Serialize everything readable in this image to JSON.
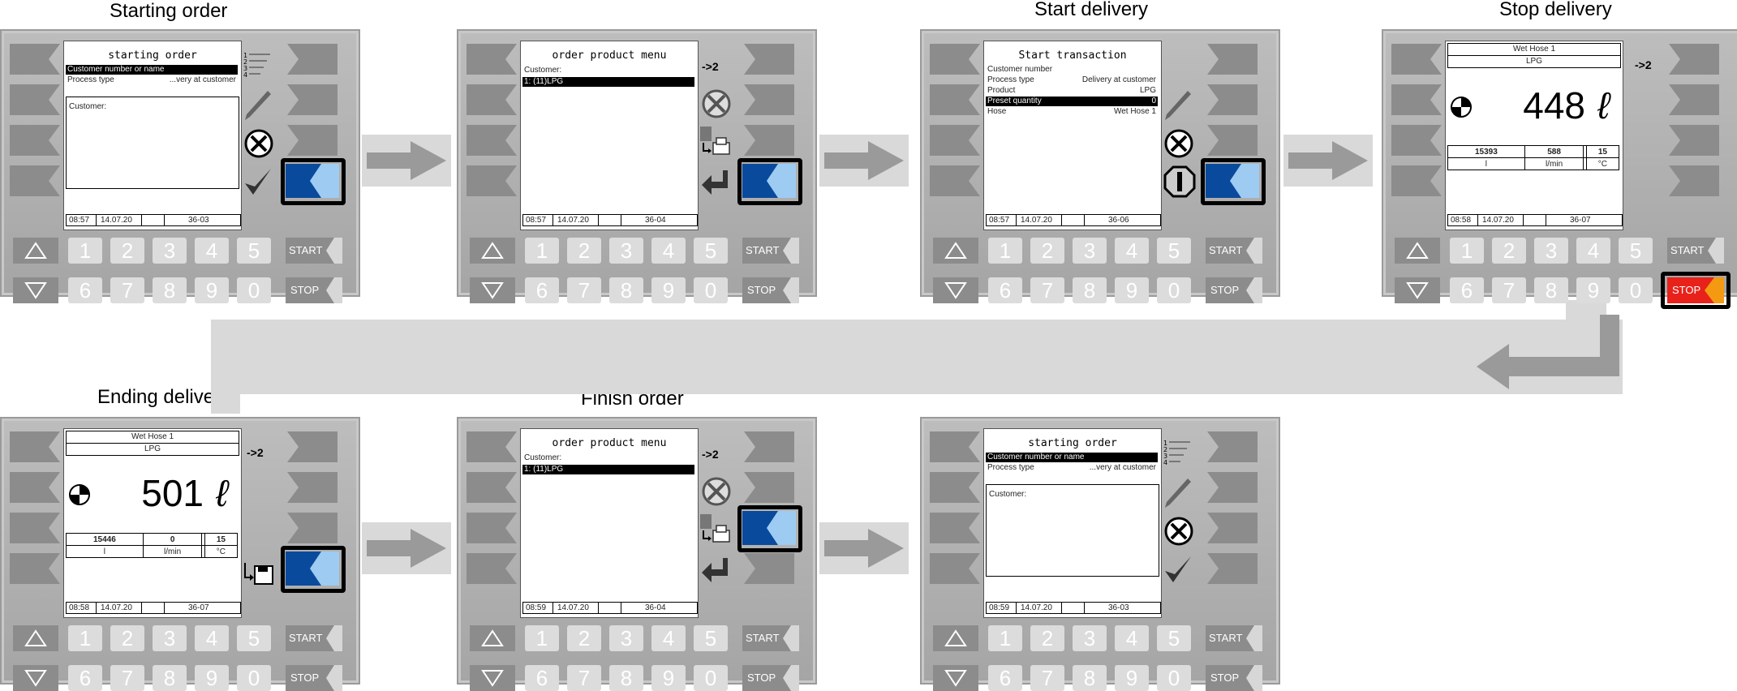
{
  "steps": [
    {
      "title": "Starting order"
    },
    {
      "title": "Start delivery"
    },
    {
      "title": "Stop delivery"
    },
    {
      "title": "Ending delivery"
    },
    {
      "title": "Finish order"
    }
  ],
  "panels": {
    "p1": {
      "screen_title": "starting order",
      "rows": [
        {
          "label": "Customer number or name",
          "value": ""
        },
        {
          "label": "Process type",
          "value": "...very at customer"
        }
      ],
      "box_label": "Customer:",
      "status": {
        "time": "08:57",
        "date": "14.07.20",
        "code": "36-03"
      }
    },
    "p2": {
      "screen_title": "order product menu",
      "customer_label": "Customer:",
      "list_item": "1:  (11)LPG",
      "goto": "->2",
      "status": {
        "time": "08:57",
        "date": "14.07.20",
        "code": "36-04"
      }
    },
    "p3": {
      "screen_title": "Start transaction",
      "rows": [
        {
          "label": "Customer number",
          "value": ""
        },
        {
          "label": "Process type",
          "value": "Delivery at customer"
        },
        {
          "label": "Product",
          "value": "LPG"
        },
        {
          "label": "Preset quantity",
          "value": "0"
        },
        {
          "label": "Hose",
          "value": "Wet Hose 1"
        }
      ],
      "status": {
        "time": "08:57",
        "date": "14.07.20",
        "code": "36-06"
      }
    },
    "p4": {
      "hose": "Wet Hose 1",
      "product": "LPG",
      "goto": "->2",
      "quantity": "448",
      "unit": "ℓ",
      "table_values": [
        "15393",
        "588",
        "",
        "15"
      ],
      "table_units": [
        "l",
        "l/min",
        "",
        "°C"
      ],
      "status": {
        "time": "08:58",
        "date": "14.07.20",
        "code": "36-07"
      }
    },
    "p5": {
      "hose": "Wet Hose 1",
      "product": "LPG",
      "goto": "->2",
      "quantity": "501",
      "unit": "ℓ",
      "table_values": [
        "15446",
        "0",
        "",
        "15"
      ],
      "table_units": [
        "l",
        "l/min",
        "",
        "°C"
      ],
      "status": {
        "time": "08:58",
        "date": "14.07.20",
        "code": "36-07"
      }
    },
    "p6": {
      "screen_title": "order product menu",
      "customer_label": "Customer:",
      "list_item": "1:  (11)LPG",
      "goto": "->2",
      "status": {
        "time": "08:59",
        "date": "14.07.20",
        "code": "36-04"
      }
    },
    "p7": {
      "screen_title": "starting order",
      "rows": [
        {
          "label": "Customer number or name",
          "value": ""
        },
        {
          "label": "Process type",
          "value": "...very at customer"
        }
      ],
      "box_label": "Customer:",
      "status": {
        "time": "08:59",
        "date": "14.07.20",
        "code": "36-03"
      }
    }
  },
  "keypad": {
    "row1": [
      "1",
      "2",
      "3",
      "4",
      "5"
    ],
    "row2": [
      "6",
      "7",
      "8",
      "9",
      "0"
    ],
    "start_label": "START",
    "stop_label": "STOP"
  },
  "colors": {
    "highlight_blue": "#0a4a9c",
    "highlight_light": "#9ecbf2",
    "stop_red": "#e8221b",
    "stop_orange": "#f39a12",
    "key_gray": "#8c8c8c"
  }
}
